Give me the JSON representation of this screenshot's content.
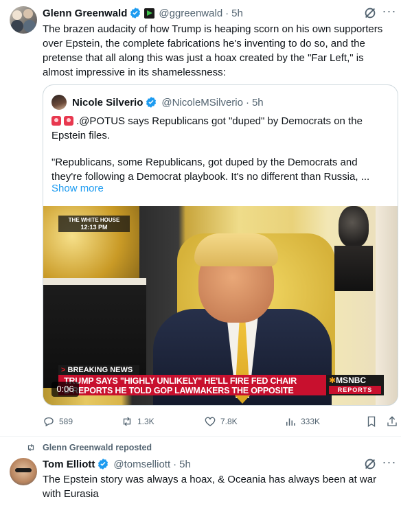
{
  "tweet": {
    "author_name": "Glenn Greenwald",
    "handle": "@ggreenwald",
    "separator": "·",
    "time": "5h",
    "text": "The brazen audacity of how Trump is heaping scorn on his own supporters over Epstein, the complete fabrications he's inventing to do so, and the pretense that all along this was just a hoax created by the \"Far Left,\" is almost impressive in its shamelessness:",
    "text_lines": [
      "The brazen audacity of how Trump is heaping scorn on his own supporters",
      "over Epstein, the complete fabrications he's inventing to do so, and the",
      "pretense that all along this was just a hoax created by the \"Far Left,\" is",
      "almost impressive in its shamelessness:"
    ],
    "quote": {
      "author_name": "Nicole Silverio",
      "handle": "@NicoleMSilverio",
      "separator": "·",
      "time": "5h",
      "line1": ".@POTUS says Republicans got \"duped\" by Democrats on the",
      "line2": "Epstein files.",
      "line3": "\"Republicans, some Republicans, got duped by the Democrats and",
      "line4": "they're following a Democrat playbook. It's no different than Russia, ...",
      "show_more": "Show more",
      "video": {
        "overlay_top_line1": "THE WHITE HOUSE",
        "overlay_top_line2": "12:13 PM",
        "breaking_label": "BREAKING NEWS",
        "breaking_arrow": ">",
        "chyron_line1": "TRUMP SAYS \"HIGHLY UNLIKELY\" HE'LL FIRE FED CHAIR",
        "chyron_line2": "D REPORTS HE TOLD GOP LAWMAKERS THE OPPOSITE",
        "network_logo": "MSNBC",
        "network_tag": "REPORTS",
        "timestamp": "0:06"
      }
    },
    "actions": {
      "replies": "589",
      "reposts": "1.3K",
      "likes": "7.8K",
      "views": "333K"
    }
  },
  "repost_banner": "Glenn Greenwald reposted",
  "tweet2": {
    "author_name": "Tom Elliott",
    "handle": "@tomselliott",
    "separator": "·",
    "time": "5h",
    "text_line1": "The Epstein story was always a hoax, & Oceania has always been at war",
    "text_line2": "with Eurasia"
  },
  "colors": {
    "verified_blue": "#1d9bf0",
    "secondary_text": "#536471",
    "chyron_red": "#c8102e"
  }
}
